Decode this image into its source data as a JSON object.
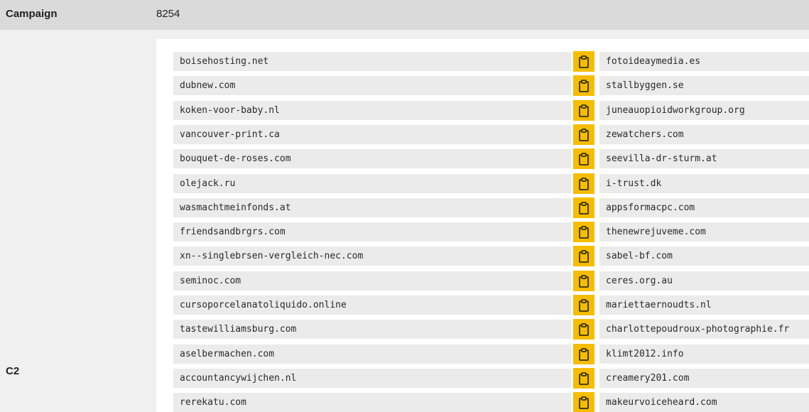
{
  "campaign": {
    "label": "Campaign",
    "value": "8254"
  },
  "c2_label": "C2",
  "copy_icon": "clipboard-icon",
  "rows": [
    {
      "left": "boisehosting.net",
      "right": "fotoideaymedia.es"
    },
    {
      "left": "dubnew.com",
      "right": "stallbyggen.se"
    },
    {
      "left": "koken-voor-baby.nl",
      "right": "juneauopioidworkgroup.org"
    },
    {
      "left": "vancouver-print.ca",
      "right": "zewatchers.com"
    },
    {
      "left": "bouquet-de-roses.com",
      "right": "seevilla-dr-sturm.at"
    },
    {
      "left": "olejack.ru",
      "right": "i-trust.dk"
    },
    {
      "left": "wasmachtmeinfonds.at",
      "right": "appsformacpc.com"
    },
    {
      "left": "friendsandbrgrs.com",
      "right": "thenewrejuveme.com"
    },
    {
      "left": "xn--singlebrsen-vergleich-nec.com",
      "right": "sabel-bf.com"
    },
    {
      "left": "seminoc.com",
      "right": "ceres.org.au"
    },
    {
      "left": "cursoporcelanatoliquido.online",
      "right": "mariettaernoudts.nl"
    },
    {
      "left": "tastewilliamsburg.com",
      "right": "charlottepoudroux-photographie.fr"
    },
    {
      "left": "aselbermachen.com",
      "right": "klimt2012.info"
    },
    {
      "left": "accountancywijchen.nl",
      "right": "creamery201.com"
    },
    {
      "left": "rerekatu.com",
      "right": "makeurvoiceheard.com"
    }
  ]
}
